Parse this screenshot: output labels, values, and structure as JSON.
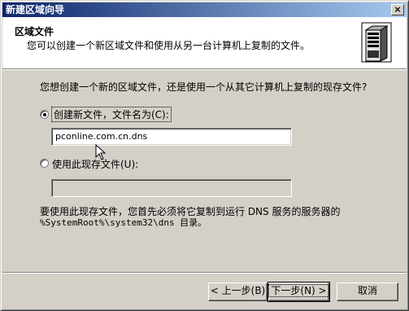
{
  "window": {
    "title": "新建区域向导",
    "close_label": "×"
  },
  "header": {
    "title": "区域文件",
    "subtitle": "您可以创建一个新区域文件和使用从另一台计算机上复制的文件。"
  },
  "question": "您想创建一个新的区域文件，还是使用一个从其它计算机上复制的现存文件?",
  "options": {
    "create_label": "创建新文件，文件名为(C):",
    "create_value": "pconline.com.cn.dns",
    "existing_label": "使用此现存文件(U):",
    "existing_value": ""
  },
  "note": {
    "line1": "要使用此现存文件，您首先必须将它复制到运行 DNS 服务的服务器的",
    "line2": "%SystemRoot%\\system32\\dns 目录。"
  },
  "buttons": {
    "back": "< 上一步(B)",
    "next": "下一步(N) >",
    "cancel": "取消"
  },
  "colors": {
    "face": "#d4d0c8",
    "title_start": "#0a246a",
    "title_end": "#a6caf0"
  }
}
